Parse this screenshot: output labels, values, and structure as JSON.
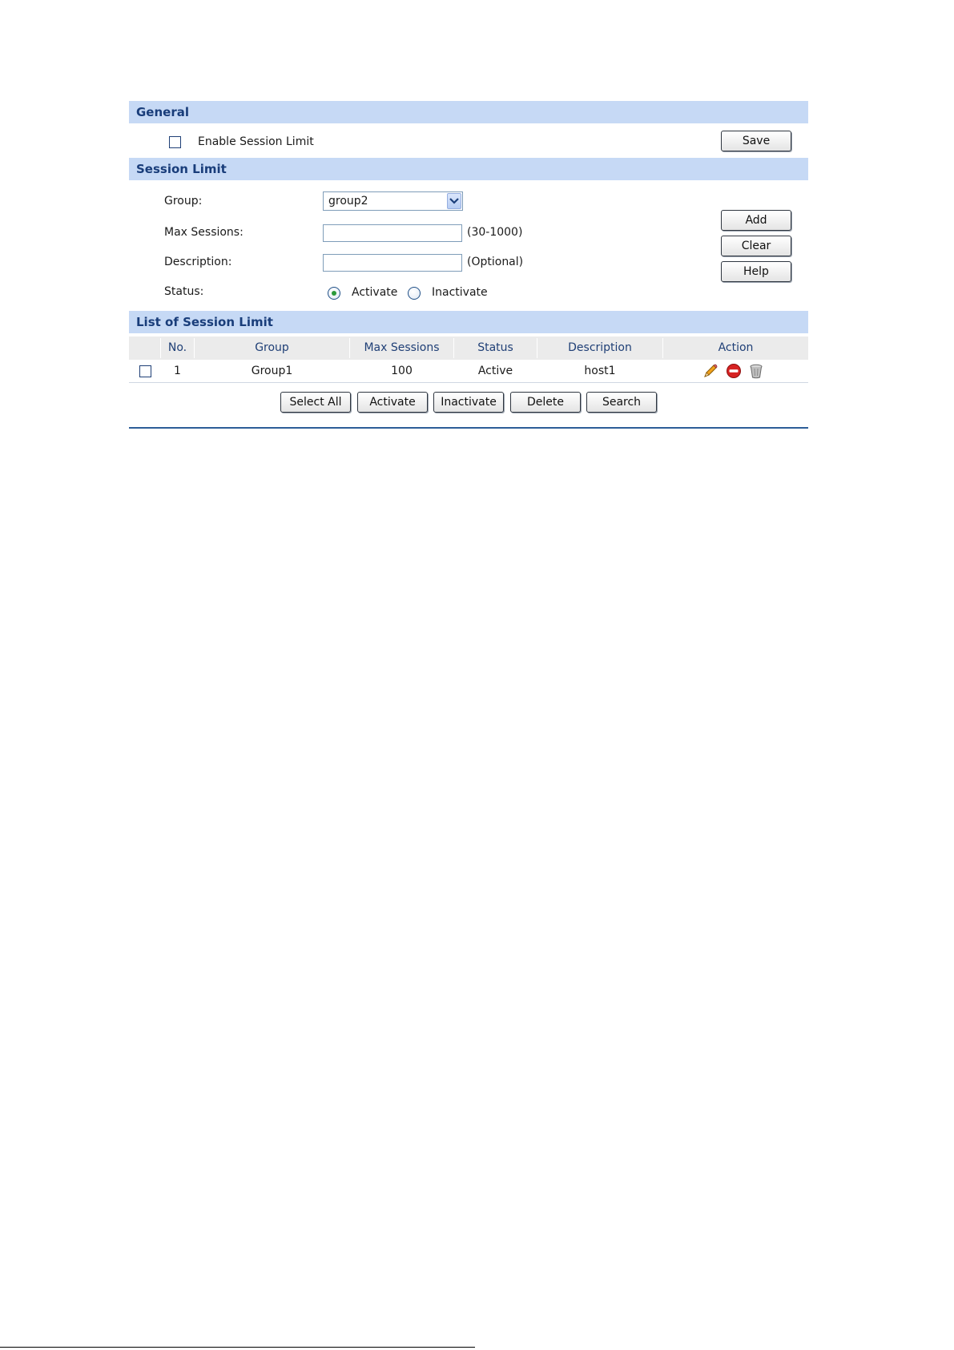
{
  "general": {
    "title": "General",
    "enable_label": "Enable Session Limit",
    "save_label": "Save"
  },
  "session_limit": {
    "title": "Session Limit",
    "group_label": "Group:",
    "group_value": "group2",
    "max_sessions_label": "Max Sessions:",
    "max_sessions_value": "",
    "max_sessions_hint": "(30-1000)",
    "description_label": "Description:",
    "description_value": "",
    "description_hint": "(Optional)",
    "status_label": "Status:",
    "status_options": [
      "Activate",
      "Inactivate"
    ],
    "status_selected": "Activate",
    "add_label": "Add",
    "clear_label": "Clear",
    "help_label": "Help"
  },
  "list": {
    "title": "List of Session Limit",
    "columns": [
      "No.",
      "Group",
      "Max Sessions",
      "Status",
      "Description",
      "Action"
    ],
    "rows": [
      {
        "no": "1",
        "group": "Group1",
        "max_sessions": "100",
        "status": "Active",
        "description": "host1",
        "actions": [
          "edit-pencil-icon",
          "disable-icon",
          "delete-trash-icon"
        ]
      }
    ],
    "buttons": {
      "select_all": "Select All",
      "activate": "Activate",
      "inactivate": "Inactivate",
      "delete": "Delete",
      "search": "Search"
    }
  },
  "colors": {
    "section_bar": "#c6d9f5",
    "section_text": "#193d7a",
    "header_row": "#ebebeb",
    "rule": "#2c5e98"
  }
}
